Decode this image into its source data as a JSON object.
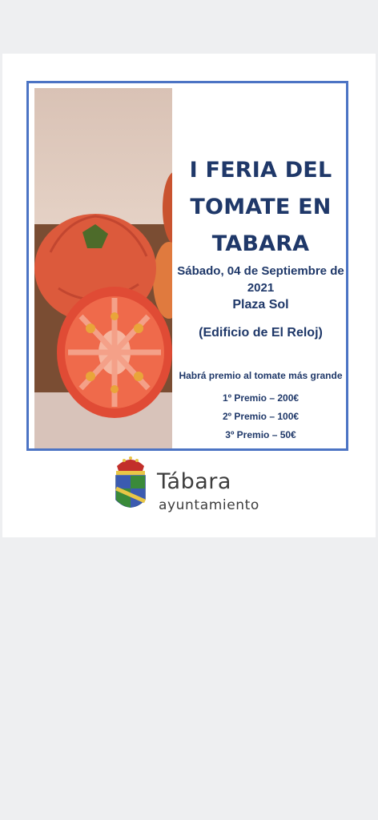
{
  "poster": {
    "title": "I FERIA DEL TOMATE EN TABARA",
    "date_line1": "Sábado, 04 de Septiembre de",
    "date_line2": "2021",
    "place": "Plaza Sol",
    "building": "(Edificio de El Reloj)",
    "prize_intro": "Habrá premio al tomate más grande",
    "prizes": [
      "1º Premio – 200€",
      "2º Premio – 100€",
      "3º Premio –  50€"
    ],
    "image": "tomatoes-photo"
  },
  "logo": {
    "name": "Tábara",
    "subtitle": "ayuntamiento",
    "emblem": "coat-of-arms-icon"
  },
  "colors": {
    "title_text": "#1f3869",
    "poster_border": "#4c74c4",
    "page_background": "#eeeff1"
  }
}
